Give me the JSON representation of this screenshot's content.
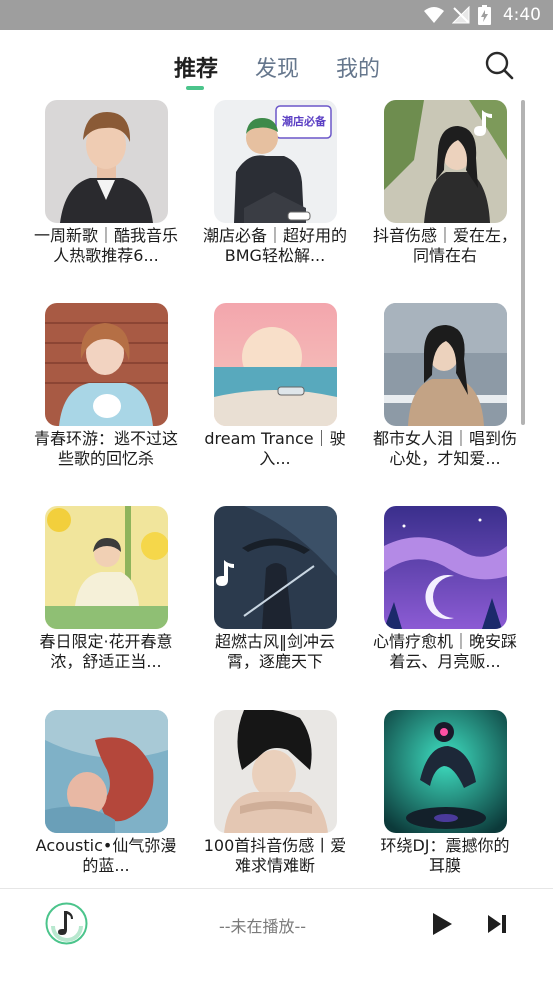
{
  "status_bar": {
    "time": "4:40",
    "icons": [
      "wifi-icon",
      "signal-off-icon",
      "battery-charging-icon"
    ]
  },
  "tabs": [
    {
      "label": "推荐",
      "active": true
    },
    {
      "label": "发现",
      "active": false
    },
    {
      "label": "我的",
      "active": false
    }
  ],
  "search_icon": "search-icon",
  "playlists": [
    {
      "title_line1": "一周新歌｜酷我音乐",
      "title_line2": "人热歌推荐6..."
    },
    {
      "title_line1": "潮店必备｜超好用的",
      "title_line2": "BMG轻松解...",
      "badge": "潮店必备"
    },
    {
      "title_line1": "抖音伤感｜爱在左，",
      "title_line2": "同情在右"
    },
    {
      "title_line1": "青春环游：逃不过这",
      "title_line2": "些歌的回忆杀"
    },
    {
      "title_line1": "dream Trance｜驶",
      "title_line2": "入..."
    },
    {
      "title_line1": "都市女人泪｜唱到伤",
      "title_line2": "心处，才知爱..."
    },
    {
      "title_line1": "春日限定·花开春意",
      "title_line2": "浓，舒适正当..."
    },
    {
      "title_line1": "超燃古风‖剑冲云",
      "title_line2": "霄，逐鹿天下"
    },
    {
      "title_line1": "心情疗愈机｜晚安踩",
      "title_line2": "着云、月亮贩..."
    },
    {
      "title_line1": "Acoustic•仙气弥漫",
      "title_line2": "的蓝..."
    },
    {
      "title_line1": "100首抖音伤感丨爱",
      "title_line2": "难求情难断"
    },
    {
      "title_line1": "环绕DJ：震撼你的",
      "title_line2": "耳膜"
    }
  ],
  "player": {
    "now_playing": "--未在播放--",
    "play_icon": "play-icon",
    "next_icon": "skip-next-icon"
  },
  "colors": {
    "accent": "#4bc48b",
    "status_bar": "#9e9e9e",
    "tab_inactive": "#66778d"
  }
}
